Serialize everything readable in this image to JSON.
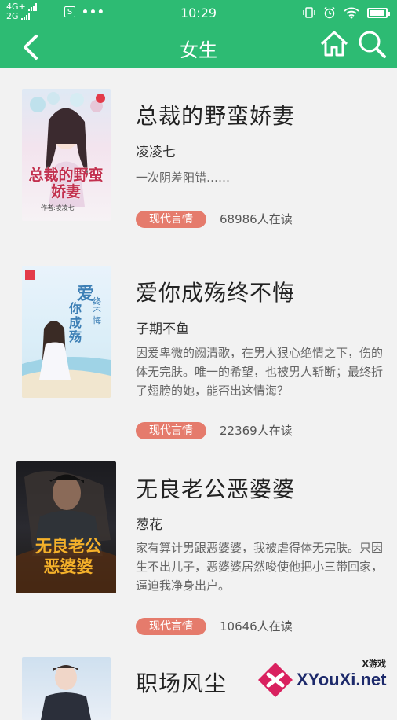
{
  "status_bar": {
    "network_top": "4G+",
    "network_bottom": "2G",
    "time": "10:29"
  },
  "header": {
    "title": "女生"
  },
  "books": [
    {
      "title": "总裁的野蛮娇妻",
      "author": "凌凌七",
      "description": "一次阴差阳错……",
      "tag": "现代言情",
      "readers": "68986人在读",
      "cover_title": "总裁的野蛮娇妻",
      "cover_byline": "作者:凌凌七"
    },
    {
      "title": "爱你成殇终不悔",
      "author": "子期不鱼",
      "description": "因爱卑微的阙清歌，在男人狠心绝情之下，伤的体无完肤。唯一的希望，也被男人斩断；最终折了翅膀的她，能否出这情海？",
      "tag": "现代言情",
      "readers": "22369人在读",
      "cover_title_line1": "爱",
      "cover_title_line2": "你成殇",
      "cover_side": "终不悔"
    },
    {
      "title": "无良老公恶婆婆",
      "author": "葱花",
      "description": "家有算计男跟恶婆婆，我被虐得体无完肤。只因生不出儿子，恶婆婆居然唆使他把小三带回家，逼迫我净身出户。",
      "tag": "现代言情",
      "readers": "10646人在读",
      "cover_title_line1": "无良老公",
      "cover_title_line2": "恶婆婆"
    },
    {
      "title": "职场风尘"
    }
  ],
  "watermark": {
    "top_text": "X游戏",
    "main_text": "XYouXi.net"
  },
  "colors": {
    "header_green": "#2dbb73",
    "tag_red": "#e57b6c",
    "background": "#f2f2f2"
  }
}
